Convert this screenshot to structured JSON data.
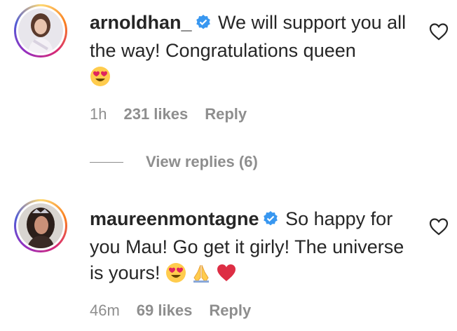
{
  "comments": [
    {
      "username": "arnoldhan_",
      "verified": true,
      "text": "We will support you all the way! Congratulations queen",
      "emojis": [
        "heart-eyes-emoji"
      ],
      "time": "1h",
      "likes": "231 likes",
      "reply": "Reply"
    },
    {
      "username": "maureenmontagne",
      "verified": true,
      "text": "So happy for you Mau! Go get it girly! The universe is yours!",
      "emojis": [
        "heart-eyes-emoji",
        "folded-hands-emoji",
        "red-heart-emoji"
      ],
      "time": "46m",
      "likes": "69 likes",
      "reply": "Reply"
    }
  ],
  "view_replies": "View replies (6)",
  "colors": {
    "text": "#262626",
    "meta": "#8e8e8e",
    "verified": "#3897f0"
  },
  "icons": [
    "verified-badge-icon",
    "heart-outline-icon"
  ]
}
